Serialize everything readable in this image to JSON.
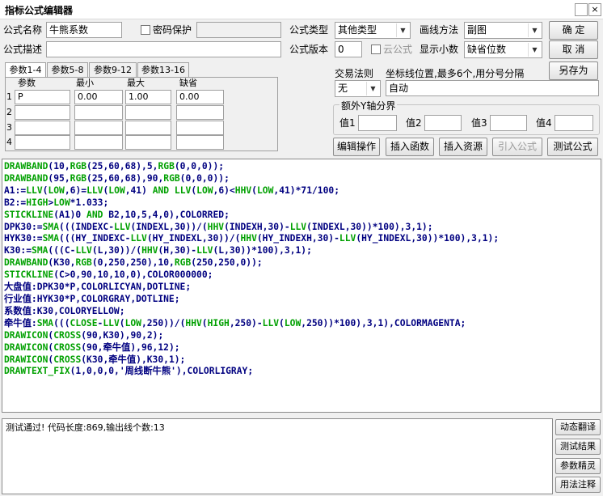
{
  "window": {
    "title": "指标公式编辑器",
    "close_symbol": "×"
  },
  "form": {
    "name_label": "公式名称",
    "name_value": "牛熊系数",
    "password_label": "密码保护",
    "desc_label": "公式描述",
    "desc_value": "",
    "type_label": "公式类型",
    "type_value": "其他类型",
    "draw_method_label": "画线方法",
    "draw_method_value": "副图",
    "version_label": "公式版本",
    "version_value": "0",
    "cloud_label": "云公式",
    "decimals_label": "显示小数",
    "decimals_value": "缺省位数"
  },
  "buttons": {
    "ok": "确  定",
    "cancel": "取  消",
    "save_as": "另存为",
    "edit_ops": "编辑操作",
    "insert_func": "插入函数",
    "insert_res": "插入资源",
    "import_formula": "引入公式",
    "test_formula": "测试公式"
  },
  "tabs": [
    "参数1-4",
    "参数5-8",
    "参数9-12",
    "参数13-16"
  ],
  "params": {
    "headers": [
      "参数",
      "最小",
      "最大",
      "缺省"
    ],
    "rows": [
      {
        "n": "1",
        "name": "P",
        "min": "0.00",
        "max": "1.00",
        "def": "0.00"
      },
      {
        "n": "2",
        "name": "",
        "min": "",
        "max": "",
        "def": ""
      },
      {
        "n": "3",
        "name": "",
        "min": "",
        "max": "",
        "def": ""
      },
      {
        "n": "4",
        "name": "",
        "min": "",
        "max": "",
        "def": ""
      }
    ]
  },
  "trade": {
    "label": "交易法则",
    "value": "无",
    "coord_label": "坐标线位置,最多6个,用分号分隔",
    "coord_value": "自动"
  },
  "yaxis": {
    "label": "额外Y轴分界",
    "v1": "值1",
    "v2": "值2",
    "v3": "值3",
    "v4": "值4"
  },
  "code_lines": [
    "DRAWBAND(10,RGB(25,60,68),5,RGB(0,0,0));",
    "DRAWBAND(95,RGB(25,60,68),90,RGB(0,0,0));",
    "A1:=LLV(LOW,6)=LLV(LOW,41) AND LLV(LOW,6)<HHV(LOW,41)*71/100;",
    "B2:=HIGH>LOW*1.033;",
    "STICKLINE(A1)0 AND B2,10,5,4,0),COLORRED;",
    "DPK30:=SMA(((INDEXC-LLV(INDEXL,30))/(HHV(INDEXH,30)-LLV(INDEXL,30))*100),3,1);",
    "HYK30:=SMA(((HY_INDEXC-LLV(HY_INDEXL,30))/(HHV(HY_INDEXH,30)-LLV(HY_INDEXL,30))*100),3,1);",
    "K30:=SMA(((C-LLV(L,30))/(HHV(H,30)-LLV(L,30))*100),3,1);",
    "DRAWBAND(K30,RGB(0,250,250),10,RGB(250,250,0));",
    "STICKLINE(C>0,90,10,10,0),COLOR000000;",
    "大盘值:DPK30*P,COLORLICYAN,DOTLINE;",
    "行业值:HYK30*P,COLORGRAY,DOTLINE;",
    "系数值:K30,COLORYELLOW;",
    "牵牛值:SMA(((CLOSE-LLV(LOW,250))/(HHV(HIGH,250)-LLV(LOW,250))*100),3,1),COLORMAGENTA;",
    "DRAWICON(CROSS(90,K30),90,2);",
    "DRAWICON(CROSS(90,牵牛值),96,12);",
    "DRAWICON(CROSS(K30,牵牛值),K30,1);",
    "DRAWTEXT_FIX(1,0,0,0,'周线断牛熊'),COLORLIGRAY;"
  ],
  "output": {
    "text": "测试通过! 代码长度:869,输出线个数:13"
  },
  "side_buttons": [
    "动态翻译",
    "测试结果",
    "参数精灵",
    "用法注释"
  ],
  "colors": {
    "code_text": "#000080",
    "code_keyword": "#00a000"
  }
}
